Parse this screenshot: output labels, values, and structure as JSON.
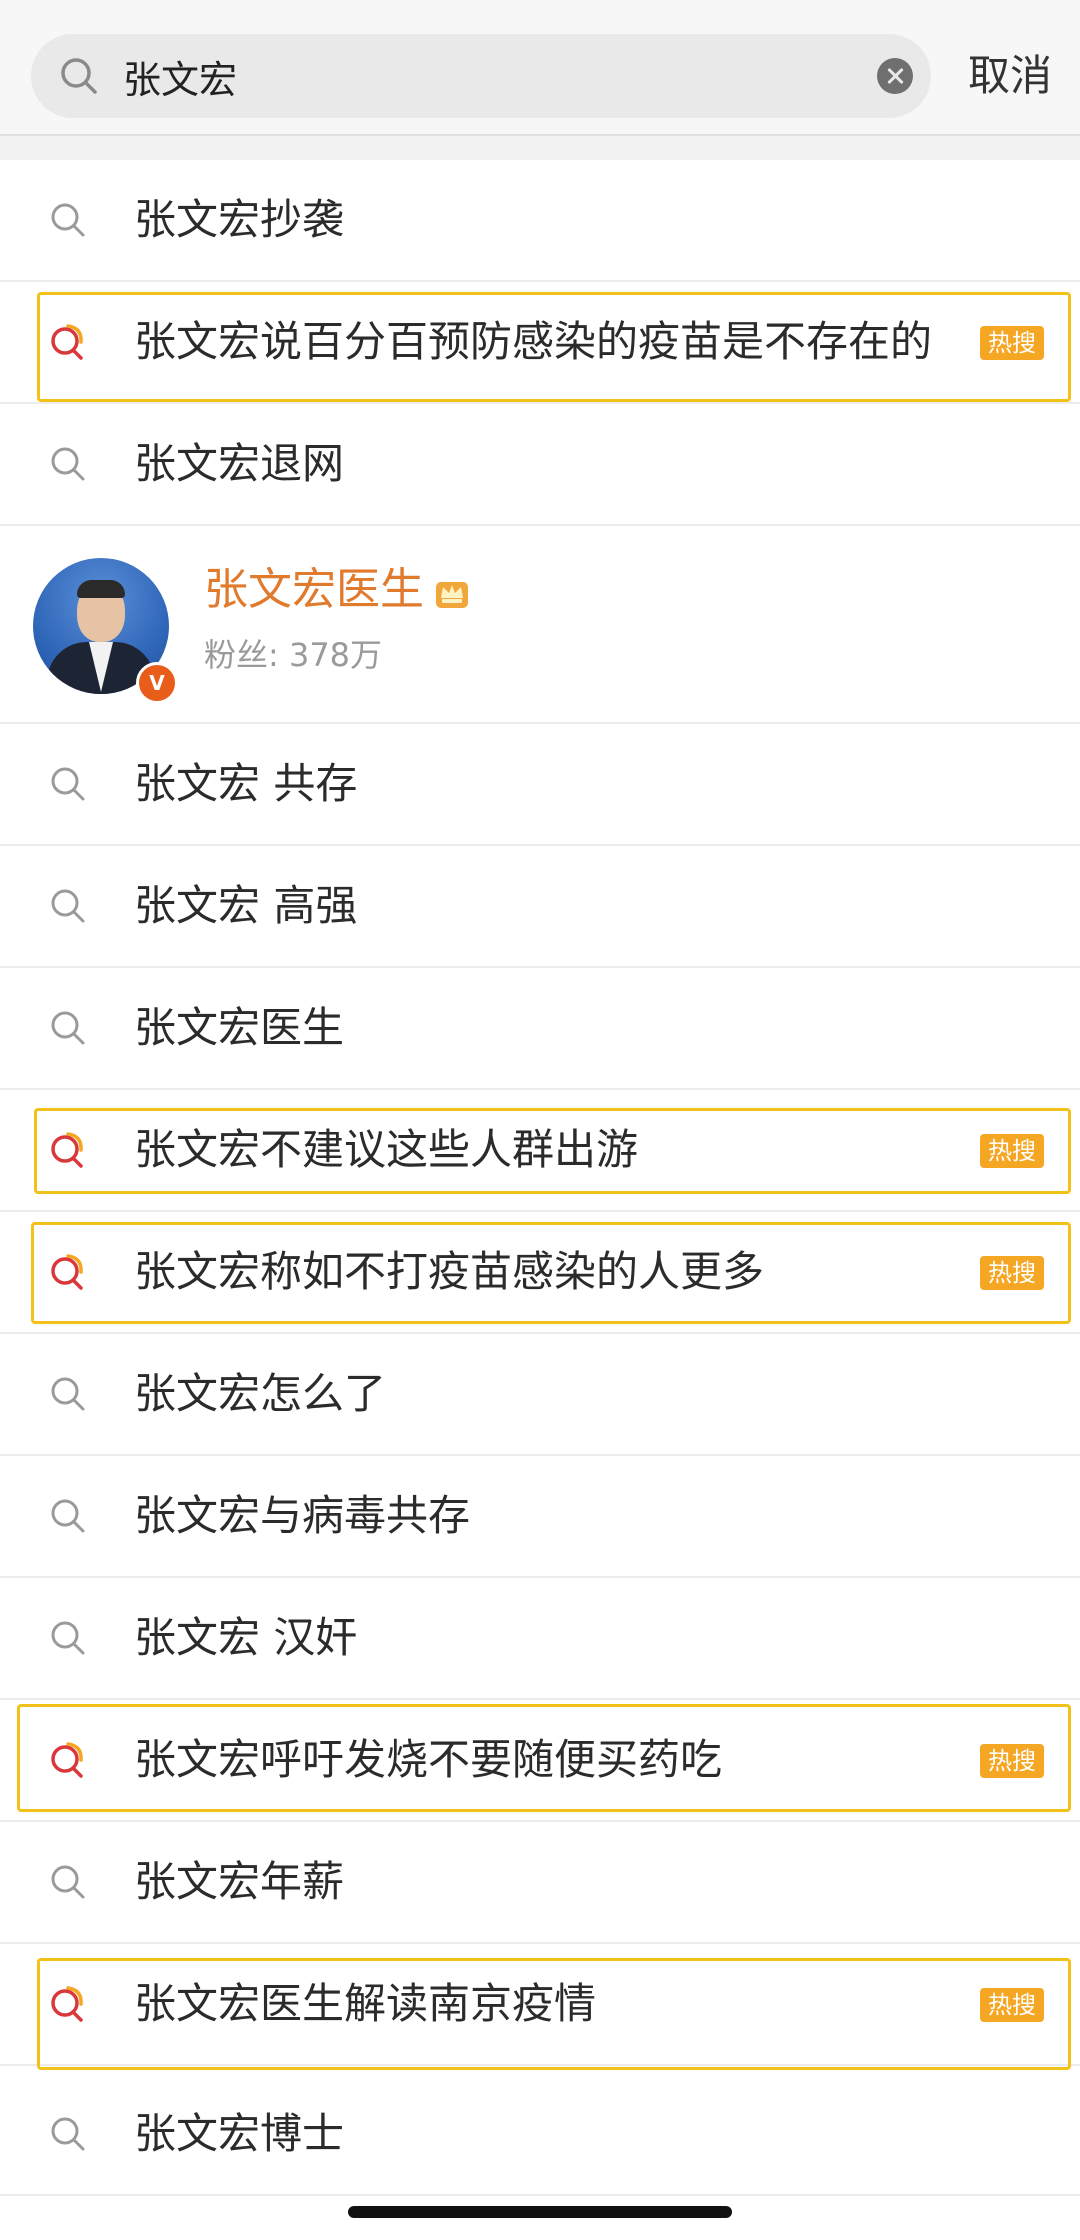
{
  "search": {
    "query": "张文宏",
    "cancel_label": "取消"
  },
  "profile": {
    "name": "张文宏医生",
    "fans": "粉丝: 378万",
    "verified_badge": "V"
  },
  "hot_badge_label": "热搜",
  "suggestions": [
    {
      "text": "张文宏抄袭",
      "hot": false
    },
    {
      "text": "张文宏说百分百预防感染的疫苗是不存在的",
      "hot": true
    },
    {
      "text": "张文宏退网",
      "hot": false
    },
    {
      "text": "张文宏 共存",
      "hot": false
    },
    {
      "text": "张文宏 高强",
      "hot": false
    },
    {
      "text": "张文宏医生",
      "hot": false
    },
    {
      "text": "张文宏不建议这些人群出游",
      "hot": true
    },
    {
      "text": "张文宏称如不打疫苗感染的人更多",
      "hot": true
    },
    {
      "text": "张文宏怎么了",
      "hot": false
    },
    {
      "text": "张文宏与病毒共存",
      "hot": false
    },
    {
      "text": "张文宏 汉奸",
      "hot": false
    },
    {
      "text": "张文宏呼吁发烧不要随便买药吃",
      "hot": true
    },
    {
      "text": "张文宏年薪",
      "hot": false
    },
    {
      "text": "张文宏医生解读南京疫情",
      "hot": true
    },
    {
      "text": "张文宏博士",
      "hot": false
    }
  ],
  "colors": {
    "accent": "#e07a2c",
    "hot_badge": "#f5a623",
    "highlight_border": "#f2c21b",
    "hot_icon": "#d9383a"
  }
}
